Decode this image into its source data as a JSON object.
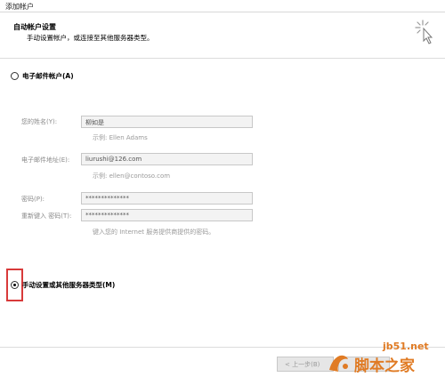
{
  "window": {
    "title": "添加帐户"
  },
  "header": {
    "title": "自动帐户设置",
    "subtitle": "手动设置帐户，或连接至其他服务器类型。"
  },
  "email_account_option": {
    "label": "电子邮件帐户(A)",
    "selected": false
  },
  "form": {
    "name": {
      "label": "您的姓名(Y):",
      "value": "柳如是",
      "hint": "示例: Ellen Adams"
    },
    "email": {
      "label": "电子邮件地址(E):",
      "value": "liurushi@126.com",
      "hint": "示例: ellen@contoso.com"
    },
    "password": {
      "label": "密码(P):",
      "value": "**************"
    },
    "password_confirm": {
      "label": "重新键入 密码(T):",
      "value": "**************"
    },
    "password_hint": "键入您的 Internet 服务提供商提供的密码。"
  },
  "manual_option": {
    "label": "手动设置或其他服务器类型(M)",
    "selected": true
  },
  "footer": {
    "back_label": "< 上一步(B)",
    "next_label": ""
  },
  "watermark": {
    "site": "jb51.net",
    "name": "脚本之家"
  },
  "colors": {
    "highlight": "#d83a3a",
    "watermark": "#e07b24"
  },
  "icons": {
    "wizard": "sparkle-cursor-icon",
    "watermark_logo": "hand-logo"
  }
}
